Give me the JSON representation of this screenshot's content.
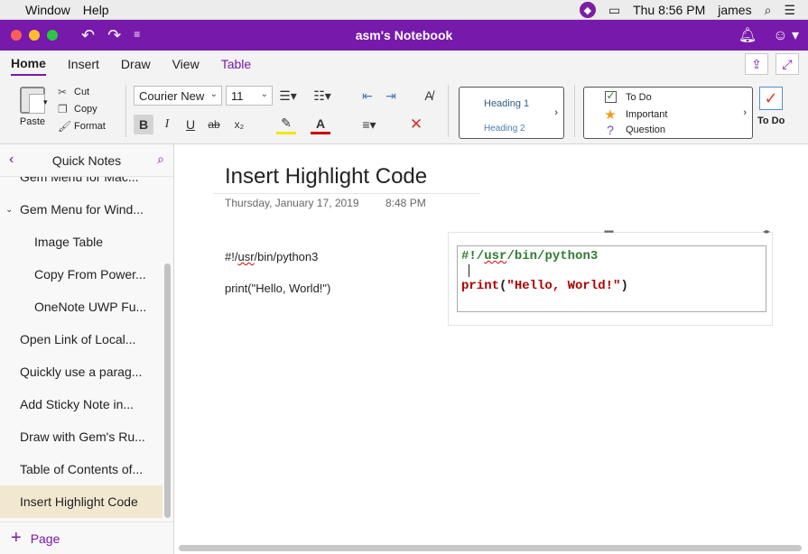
{
  "menubar": {
    "items": [
      "Window",
      "Help"
    ],
    "clock": "Thu 8:56 PM",
    "user": "james"
  },
  "titlebar": {
    "title": "asm's Notebook"
  },
  "ribbon_tabs": [
    "Home",
    "Insert",
    "Draw",
    "View",
    "Table"
  ],
  "ribbon": {
    "paste": "Paste",
    "cut": "Cut",
    "copy": "Copy",
    "format": "Format",
    "font_name": "Courier New",
    "font_size": "11",
    "bold": "B",
    "italic": "I",
    "underline": "U",
    "strike": "ab",
    "subscript": "x₂",
    "styles": {
      "heading1": "Heading 1",
      "heading2": "Heading 2"
    },
    "tags": {
      "todo": "To Do",
      "important": "Important",
      "question": "Question"
    },
    "todo_button": "To Do"
  },
  "sidebar": {
    "title": "Quick Notes",
    "pages": [
      {
        "title": "Gem Menu for Mac...",
        "level": 0
      },
      {
        "title": "Gem Menu for Wind...",
        "level": "group"
      },
      {
        "title": "Image Table",
        "level": 1
      },
      {
        "title": "Copy From Power...",
        "level": 1
      },
      {
        "title": "OneNote UWP Fu...",
        "level": 1
      },
      {
        "title": "Open Link of Local...",
        "level": 0
      },
      {
        "title": "Quickly use a parag...",
        "level": 0
      },
      {
        "title": "Add Sticky Note in...",
        "level": 0
      },
      {
        "title": "Draw with Gem's Ru...",
        "level": 0
      },
      {
        "title": "Table of Contents of...",
        "level": 0
      },
      {
        "title": "Insert Highlight Code",
        "level": 0,
        "active": true
      }
    ],
    "add_page": "Page"
  },
  "note": {
    "title": "Insert Highlight Code",
    "date": "Thursday, January 17, 2019",
    "time": "8:48 PM",
    "line1_prefix": "#!/",
    "line1_squig": "usr",
    "line1_suffix": "/bin/python3",
    "line2": "print(\"Hello, World!\")"
  },
  "code_block": {
    "line1_prefix": "#!/",
    "line1_squig": "usr",
    "line1_suffix": "/bin/python3",
    "line2_keyword": "print",
    "line2_open": "(",
    "line2_string": "\"Hello, World!\"",
    "line2_close": ")"
  },
  "colors": {
    "brand": "#7719aa",
    "code_shebang": "#2e7d32",
    "code_string": "#b00000"
  }
}
